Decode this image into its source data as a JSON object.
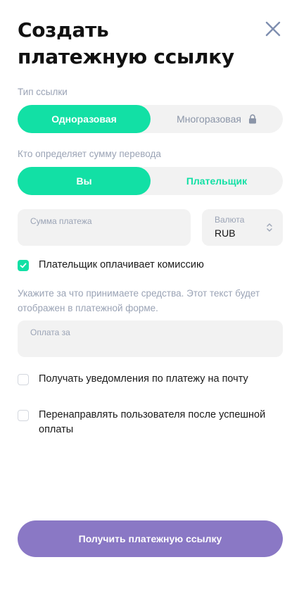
{
  "title": "Создать платежную ссылку",
  "link_type": {
    "label": "Тип ссылки",
    "options": [
      "Одноразовая",
      "Многоразовая"
    ],
    "selected": "Одноразовая",
    "locked_icon": "lock-icon"
  },
  "amount_owner": {
    "label": "Кто определяет сумму перевода",
    "options": [
      "Вы",
      "Плательщик"
    ],
    "selected": "Вы"
  },
  "amount_field": {
    "label": "Сумма платежа",
    "value": ""
  },
  "currency_field": {
    "label": "Валюта",
    "value": "RUB"
  },
  "fee_checkbox": {
    "label": "Плательщик оплачивает комиссию",
    "checked": true
  },
  "hint": "Укажите за что принимаете средства. Этот текст будет отображен в платежной форме.",
  "purpose_field": {
    "label": "Оплата за",
    "value": ""
  },
  "notify_checkbox": {
    "label": "Получать уведомления по платежу на почту",
    "checked": false
  },
  "redirect_checkbox": {
    "label": "Перенаправлять пользователя после успешной оплаты",
    "checked": false
  },
  "submit_label": "Получить платежную ссылку",
  "colors": {
    "accent": "#12e0a5",
    "button": "#8a78c5",
    "muted": "#9aa3b5",
    "field_bg": "#f2f2f2"
  }
}
